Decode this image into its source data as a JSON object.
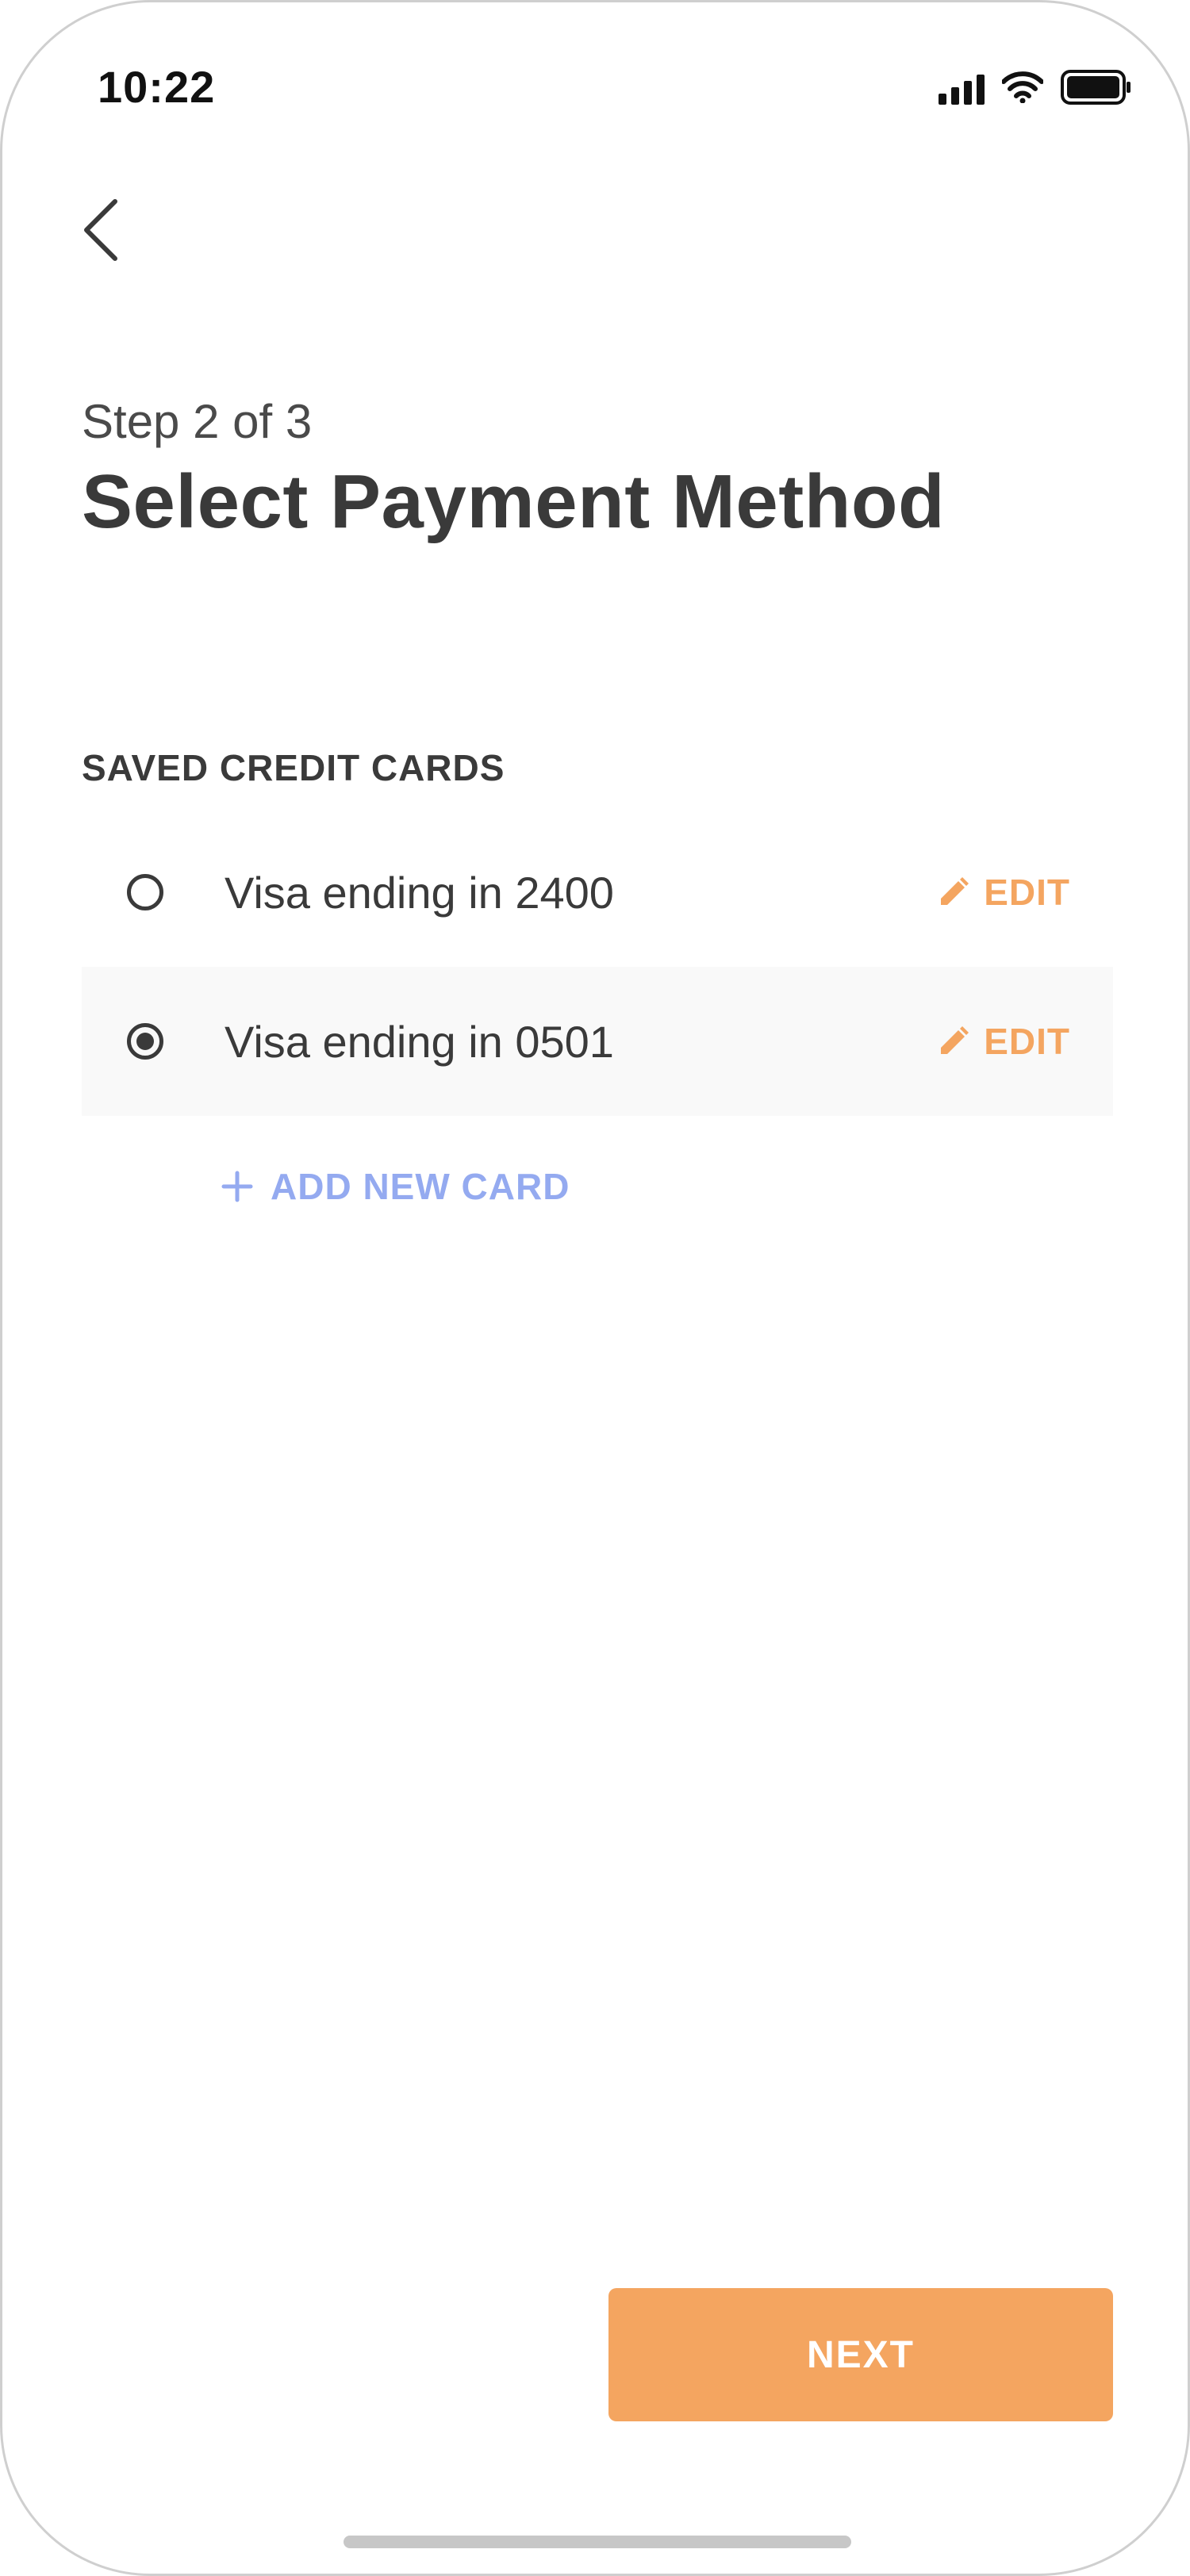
{
  "status_bar": {
    "time": "10:22",
    "icons": [
      "cellular-signal-icon",
      "wifi-icon",
      "battery-icon"
    ]
  },
  "nav": {
    "back_icon": "chevron-left-icon"
  },
  "header": {
    "step": "Step 2 of 3",
    "title": "Select Payment Method"
  },
  "saved_cards": {
    "section_label": "SAVED CREDIT CARDS",
    "items": [
      {
        "label": "Visa ending in 2400",
        "selected": false,
        "edit_label": "EDIT"
      },
      {
        "label": "Visa ending in 0501",
        "selected": true,
        "edit_label": "EDIT"
      }
    ],
    "add_label": "ADD NEW CARD"
  },
  "footer": {
    "next_label": "NEXT"
  },
  "colors": {
    "accent": "#f4a560",
    "link": "#94aaf0",
    "text": "#3a3a3a",
    "selected_row_bg": "#f9f9f9"
  }
}
